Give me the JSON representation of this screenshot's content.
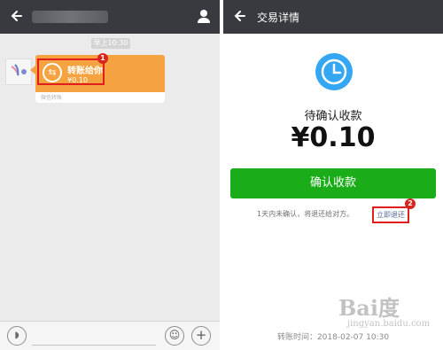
{
  "left_screen": {
    "time_label": "早上10:30",
    "bubble": {
      "title": "转账给你",
      "amount": "¥0.10",
      "footer": "微信转账"
    },
    "markers": {
      "one": "1"
    },
    "bottom_icons": [
      "voice-icon",
      "emoji-icon",
      "plus-icon"
    ]
  },
  "right_screen": {
    "title": "交易详情",
    "status": "待确认收款",
    "amount": "¥0.10",
    "confirm_button": "确认收款",
    "notice": "1天内未确认，将退还给对方。",
    "refund_link": "立即退还",
    "transfer_time": "转账时间：2018-02-07 10:30",
    "markers": {
      "two": "2"
    }
  },
  "watermark": {
    "main": "Bai度",
    "sub": "jingyan.baidu.com"
  },
  "colors": {
    "top_bar": "#393a3f",
    "orange": "#f4a340",
    "green": "#1aad19",
    "clock_blue": "#35a7f2",
    "highlight_red": "#e21d1d"
  }
}
